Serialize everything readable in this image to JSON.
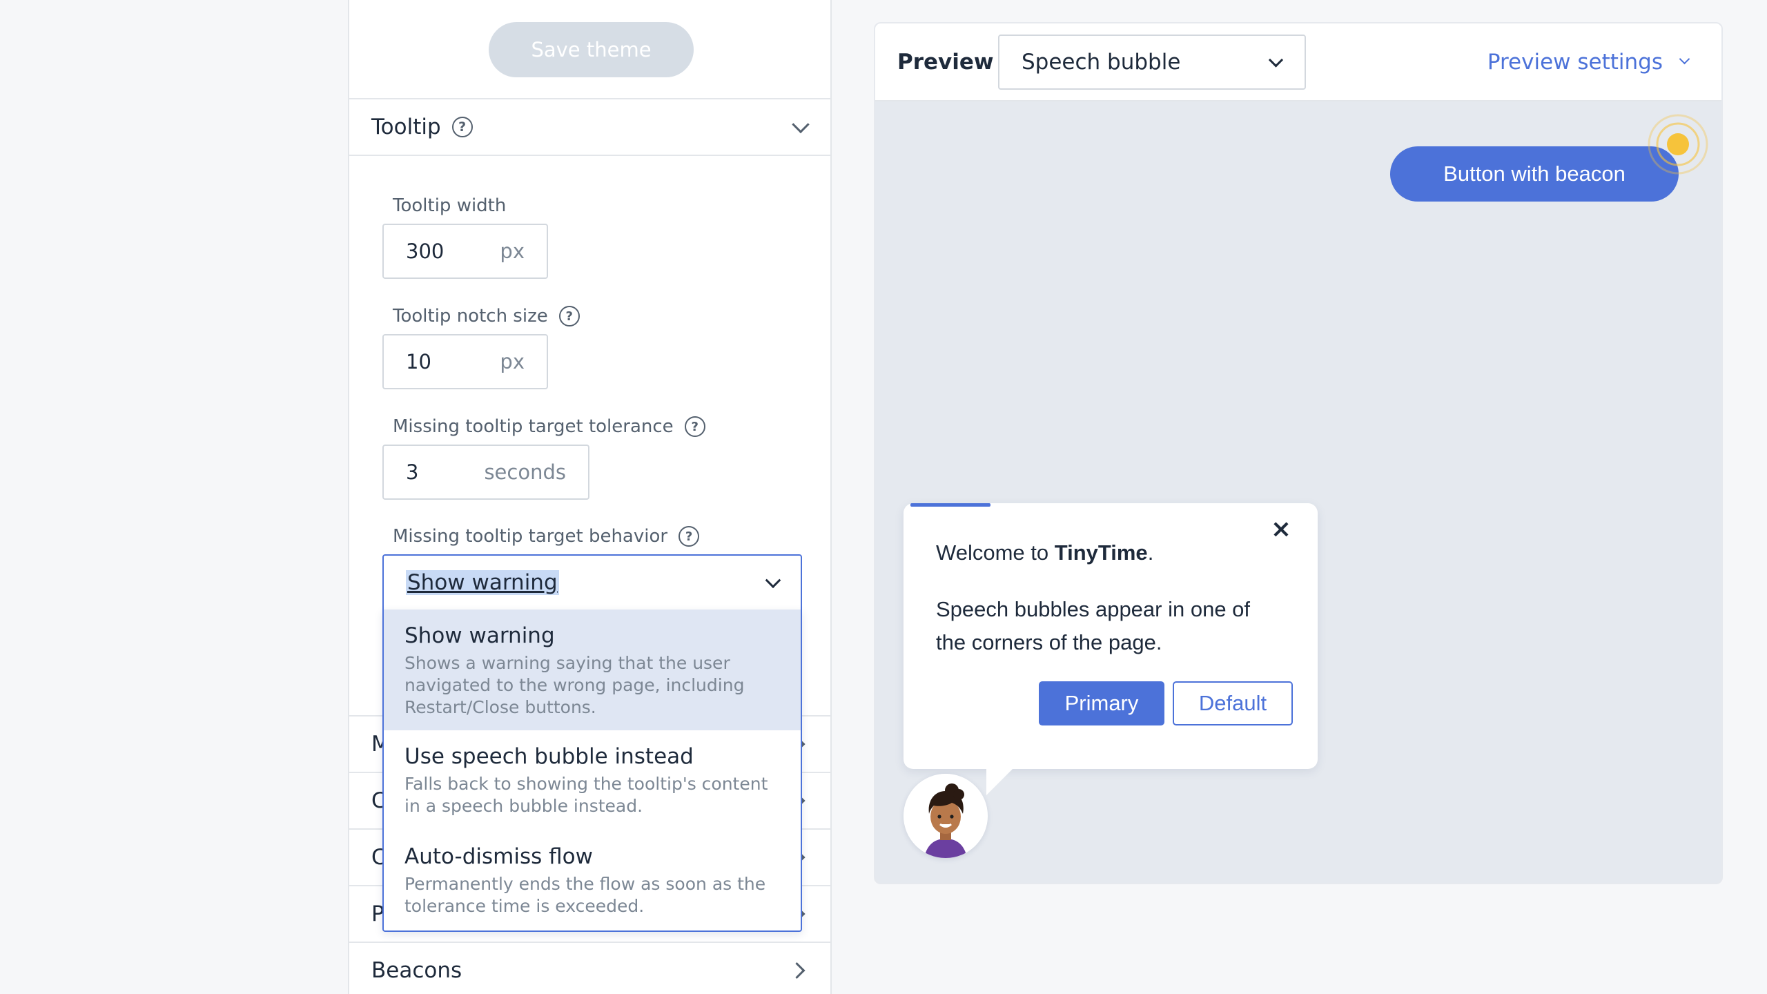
{
  "sidebar": {
    "save_button": "Save theme",
    "tooltip_section": {
      "title": "Tooltip",
      "width": {
        "label": "Tooltip width",
        "value": "300",
        "unit": "px"
      },
      "notch": {
        "label": "Tooltip notch size",
        "value": "10",
        "unit": "px"
      },
      "tolerance": {
        "label": "Missing tooltip target tolerance",
        "value": "3",
        "unit": "seconds"
      },
      "behavior": {
        "label": "Missing tooltip target behavior",
        "selected": "Show warning",
        "options": [
          {
            "title": "Show warning",
            "desc": "Shows a warning saying that the user navigated to the wrong page, including Restart/Close buttons."
          },
          {
            "title": "Use speech bubble instead",
            "desc": "Falls back to showing the tooltip's content in a speech bubble instead."
          },
          {
            "title": "Auto-dismiss flow",
            "desc": "Permanently ends the flow as soon as the tolerance time is exceeded."
          }
        ]
      }
    },
    "collapsed_sections": [
      {
        "initial": "M"
      },
      {
        "initial": "C"
      },
      {
        "initial": "C"
      },
      {
        "initial": "P"
      }
    ],
    "beacons_section": {
      "title": "Beacons"
    }
  },
  "preview": {
    "label": "Preview",
    "mode_select": "Speech bubble",
    "settings_link": "Preview settings",
    "beacon_button": "Button with beacon",
    "bubble": {
      "welcome_prefix": "Welcome to ",
      "brand": "TinyTime",
      "welcome_suffix": ".",
      "body": "Speech bubbles appear in one of the corners of the page.",
      "primary_button": "Primary",
      "default_button": "Default",
      "close_icon": "×",
      "progress": 0.2
    }
  },
  "colors": {
    "accent": "#4c72d9",
    "beacon": "#f6c33b",
    "selected_option_bg": "#dfe6f3"
  }
}
